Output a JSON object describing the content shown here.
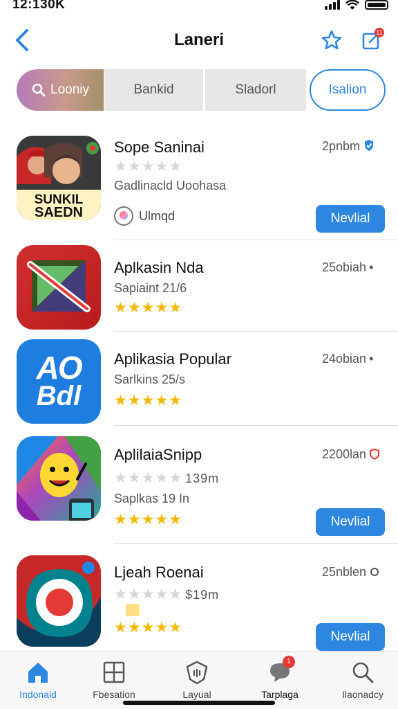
{
  "status_bar": {
    "time": "12:130K"
  },
  "header": {
    "title": "Laneri",
    "edit_badge": "11"
  },
  "tabs": [
    {
      "label": "Looniy"
    },
    {
      "label": "Bankid"
    },
    {
      "label": "Sladorl"
    },
    {
      "label": "Isalion"
    }
  ],
  "apps": [
    {
      "name": "Sope Saninai",
      "meta": "2pnbm",
      "subtitle": "Gadlinacld Uoohasa",
      "rating_filled": 0,
      "developer": "Ulmqd",
      "button": "Nevlial",
      "icon_text_1": "SUNKIL",
      "icon_text_2": "SAEDN"
    },
    {
      "name": "Aplkasin Nda",
      "meta": "25obiah",
      "subtitle": "Sapiaint 21/6",
      "rating_filled": 5
    },
    {
      "name": "Aplikasia Popular",
      "meta": "24obian",
      "subtitle": "Sarlkins 25/s",
      "rating_filled": 5,
      "icon_text_1": "AO",
      "icon_text_2": "Bdl"
    },
    {
      "name": "AplilaiaSnipp",
      "meta": "2200lan",
      "price": "139m",
      "subtitle": "Saplkas 19 In",
      "rating_filled": 5,
      "button": "Nevlial"
    },
    {
      "name": "Ljeah Roenai",
      "meta": "25nblen",
      "price": "$19m",
      "rating_filled": 5,
      "button": "Nevlial"
    }
  ],
  "bottom_nav": [
    {
      "label": "Indonaid",
      "icon": "home-icon"
    },
    {
      "label": "Fbesation",
      "icon": "grid-icon"
    },
    {
      "label": "Layual",
      "icon": "shield-icon"
    },
    {
      "label": "Tarplaga",
      "icon": "chat-icon",
      "badge": "1"
    },
    {
      "label": "Ilaonadcy",
      "icon": "search-icon"
    }
  ],
  "colors": {
    "accent": "#2d87e0",
    "star": "#f5b800",
    "badge": "#e53935"
  }
}
